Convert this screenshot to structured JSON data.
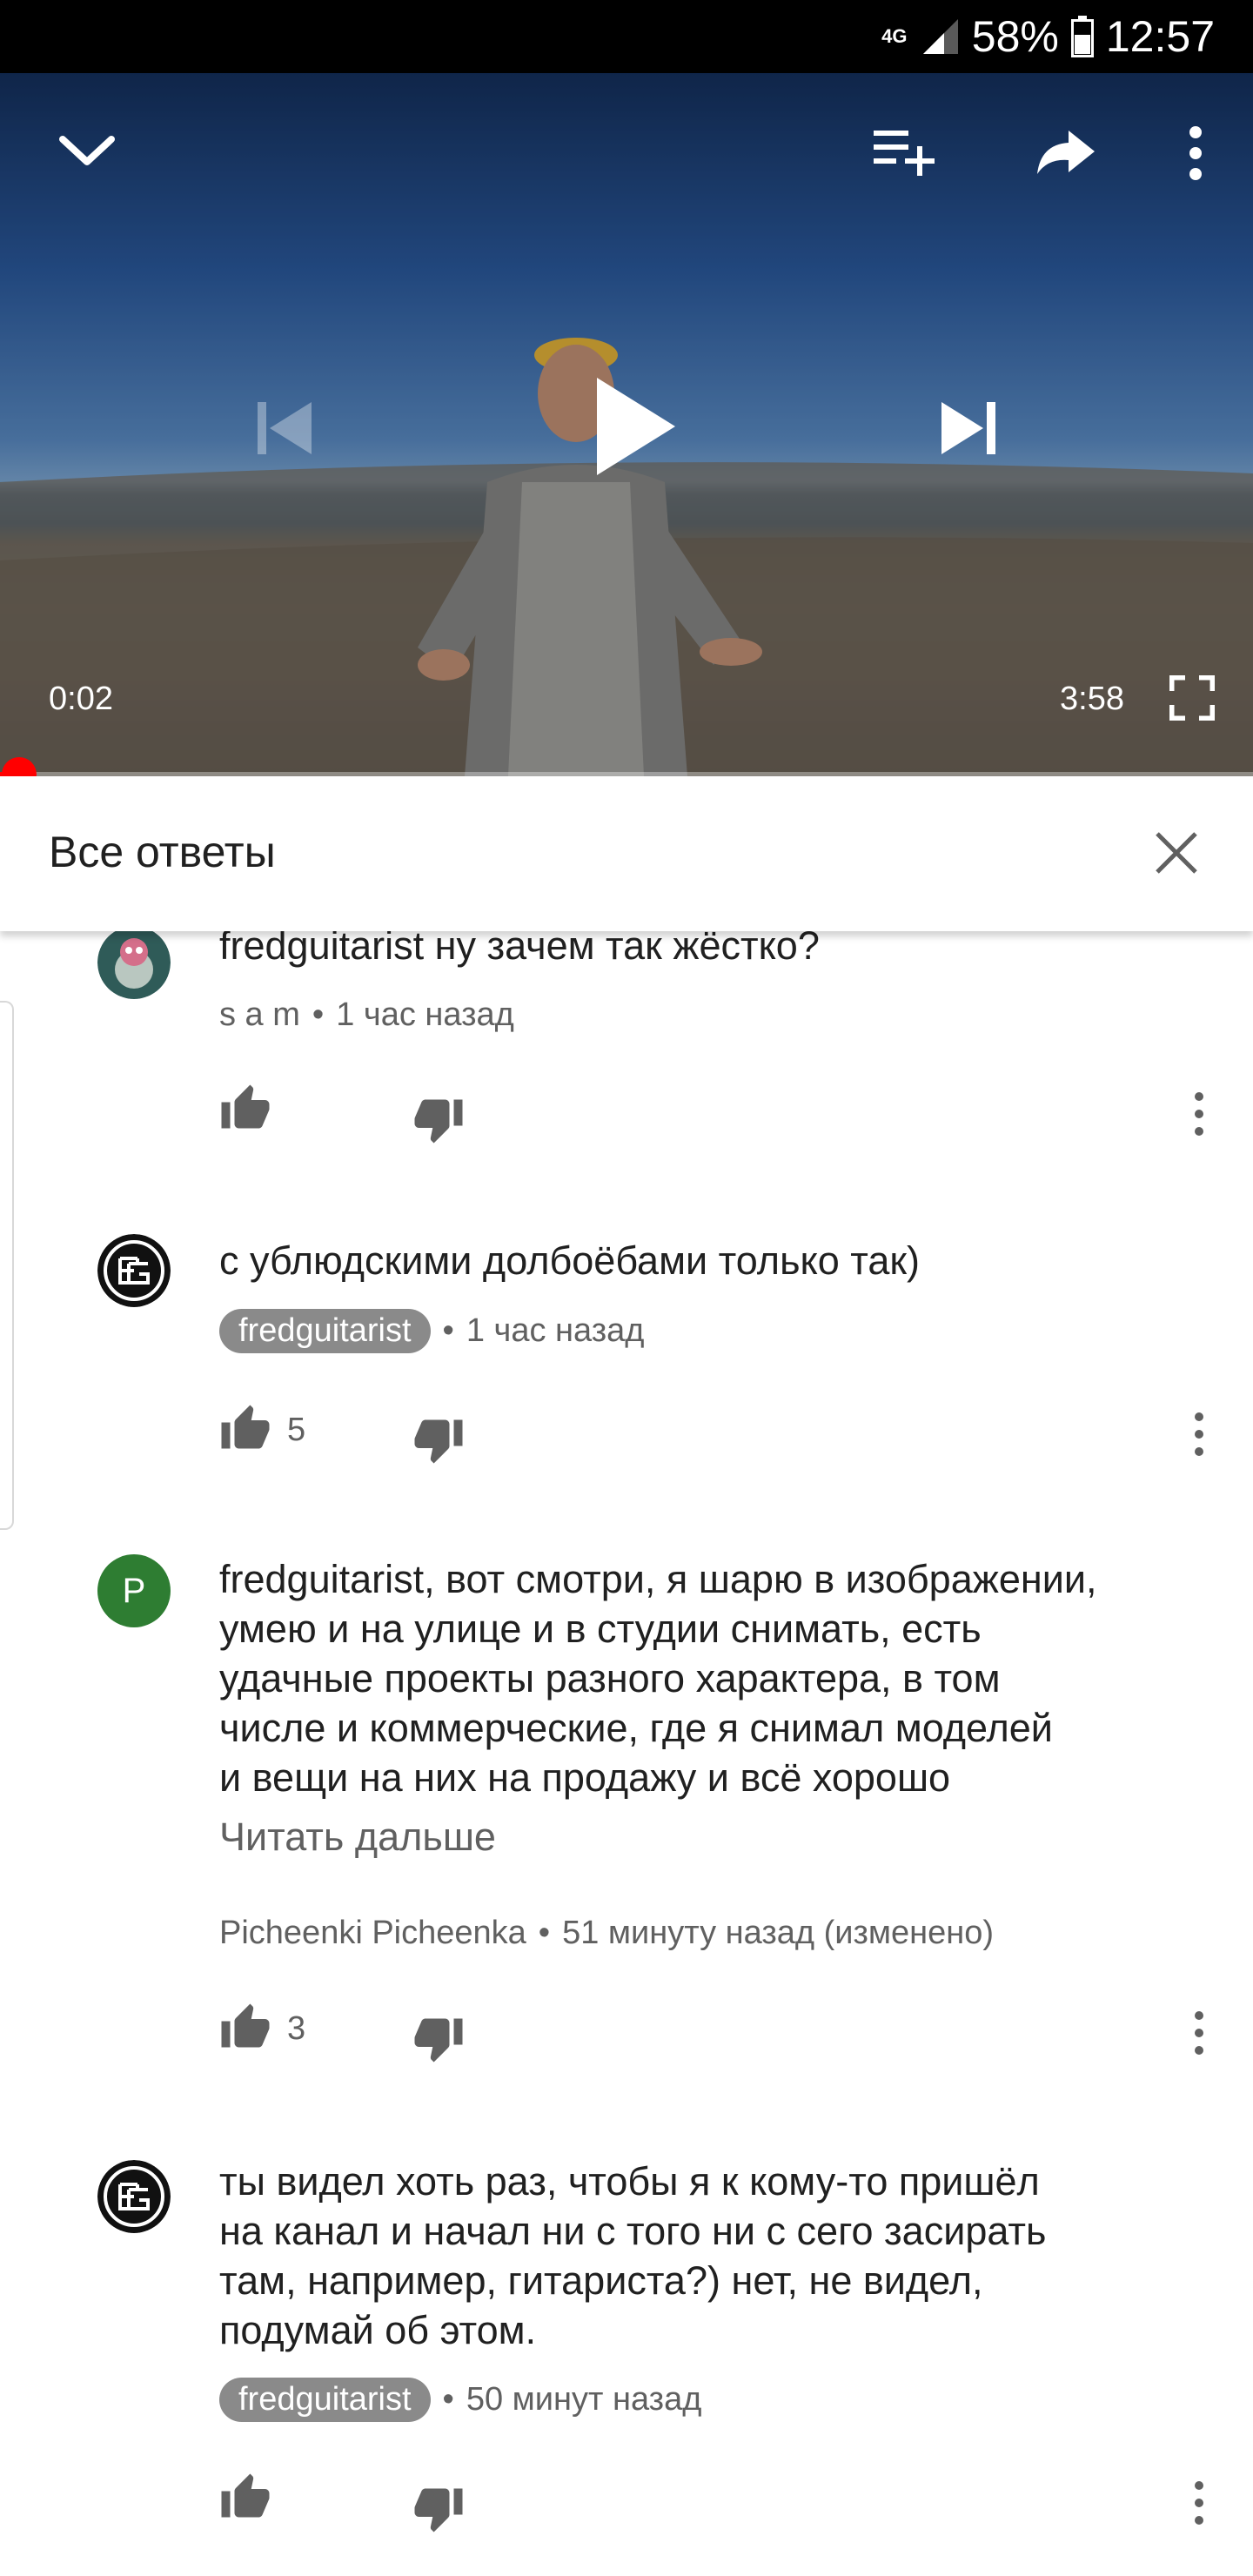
{
  "status_bar": {
    "network": "4G",
    "battery": "58%",
    "time": "12:57"
  },
  "player": {
    "current_time": "0:02",
    "duration": "3:58",
    "progress": 0.008
  },
  "panel": {
    "title": "Все ответы"
  },
  "comments": [
    {
      "text": "fredguitarist ну зачем так жёстко?",
      "author": "s a m",
      "time": "1 час назад",
      "likes": ""
    },
    {
      "text": "с ублюдскими долбоёбами только так)",
      "author": "fredguitarist",
      "time": "1 час назад",
      "likes": "5"
    },
    {
      "avatar_letter": "P",
      "lines": [
        "fredguitarist, вот смотри, я шарю в изображении,",
        "умею и на улице и в студии снимать, есть",
        "удачные проекты разного характера, в том",
        "числе и коммерческие, где я снимал моделей",
        "и вещи на них на продажу и всё хорошо"
      ],
      "read_more": "Читать дальше",
      "author": "Picheenki Picheenka",
      "time": "51 минуту назад (изменено)",
      "likes": "3"
    },
    {
      "lines": [
        "ты видел хоть раз, чтобы я к кому-то пришёл",
        "на канал и начал ни с того ни с сего засирать",
        "там, например, гитариста?) нет, не видел,",
        "подумай об этом."
      ],
      "author": "fredguitarist",
      "time": "50 минут назад",
      "likes": ""
    }
  ],
  "colors": {
    "accent": "#ff0000",
    "avatar_green": "#2e7d32",
    "chip": "#8a8a8a"
  }
}
